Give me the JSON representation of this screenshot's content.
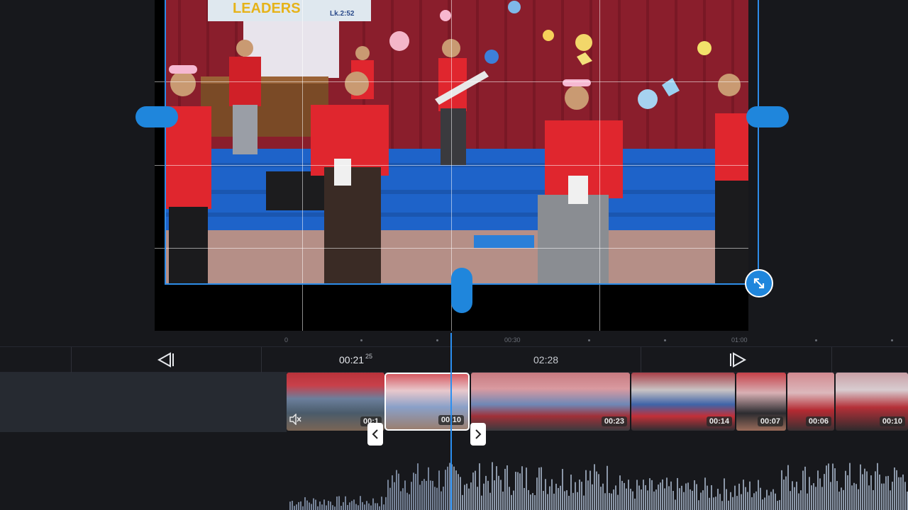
{
  "preview": {
    "banner_text": "LEADERS",
    "banner_ref": "Lk.2:52"
  },
  "ruler": {
    "labels": [
      "0",
      "00:30",
      "01:00"
    ]
  },
  "toolbar": {
    "current_time": "00:21",
    "current_frames": "25",
    "total_duration": "02:28"
  },
  "clips": [
    {
      "duration": "00:1",
      "muted": true
    },
    {
      "duration": "00:10",
      "selected": true
    },
    {
      "duration": "00:23"
    },
    {
      "duration": "00:14"
    },
    {
      "duration": "00:07"
    },
    {
      "duration": "00:06"
    },
    {
      "duration": "00:10"
    }
  ],
  "colors": {
    "accent": "#2b8ff0",
    "background": "#17181c",
    "shirt_red": "#e0262e",
    "stage_blue": "#1e63c9",
    "curtain": "#8a1e2c"
  }
}
